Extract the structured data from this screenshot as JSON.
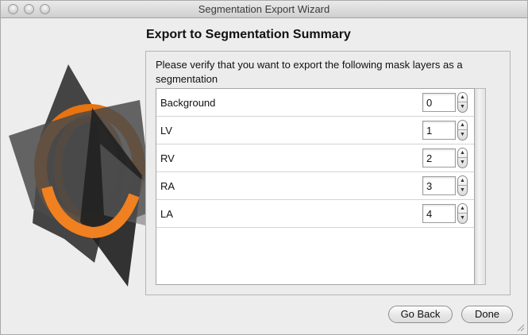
{
  "window": {
    "title": "Segmentation Export Wizard"
  },
  "page": {
    "heading": "Export to Segmentation Summary",
    "prompt": "Please verify that you want to export the following mask layers as a segmentation"
  },
  "layers": [
    {
      "name": "Background",
      "value": "0"
    },
    {
      "name": "LV",
      "value": "1"
    },
    {
      "name": "RV",
      "value": "2"
    },
    {
      "name": "RA",
      "value": "3"
    },
    {
      "name": "LA",
      "value": "4"
    }
  ],
  "buttons": {
    "back": "Go Back",
    "done": "Done"
  },
  "icons": {
    "logo": "segmentation-planes-logo-icon",
    "up": "stepper-up-icon",
    "down": "stepper-down-icon"
  },
  "colors": {
    "accent": "#e8730f",
    "plane": "#2c2c2c"
  }
}
